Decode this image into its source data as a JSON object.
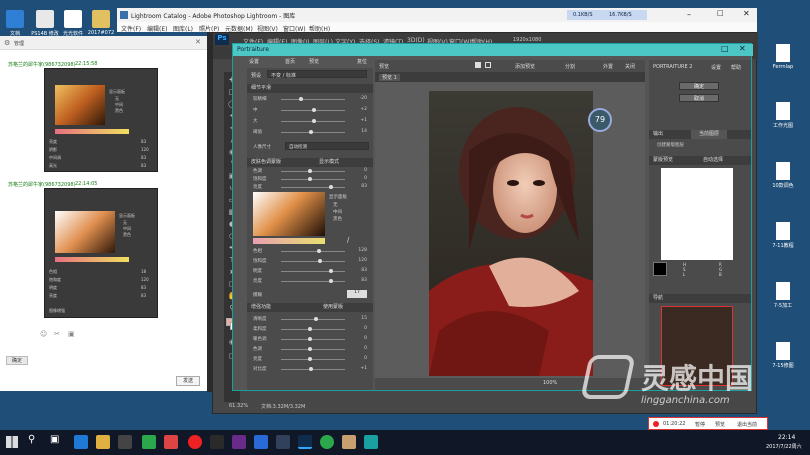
{
  "desktop": {
    "left_icons": [
      {
        "label": "文档"
      },
      {
        "label": "PS14B 修改"
      },
      {
        "label": "光光软件"
      },
      {
        "label": "2017#072"
      }
    ],
    "right_icons": [
      {
        "label": "Ferrnlap"
      },
      {
        "label": "工作光图"
      },
      {
        "label": "10款调色"
      },
      {
        "label": "7-11教程"
      },
      {
        "label": "7-5加工"
      },
      {
        "label": "7-15修图"
      }
    ]
  },
  "lightroom": {
    "title": "Lightroom Catalog - Adobe Photoshop Lightroom - 图库",
    "menu": [
      "文件(F)",
      "编辑(E)",
      "图库(L)",
      "照片(P)",
      "元数据(M)",
      "视图(V)",
      "窗口(W)",
      "帮助(H)"
    ],
    "net_down": "0.1KB/S",
    "net_up": "16.7KB/S"
  },
  "chat": {
    "header": "管理",
    "messages": [
      {
        "name": "苏格兰的犀牛家(986732098)",
        "time": "22:15:58"
      },
      {
        "name": "苏格兰的犀牛家(986732098)",
        "time": "22:14:05"
      }
    ],
    "panel1": {
      "rows": [
        [
          "亮度",
          "83"
        ],
        [
          "阴影",
          "120"
        ],
        [
          "中间调",
          "83"
        ],
        [
          "高光",
          "83"
        ],
        [
          "基本",
          "40"
        ]
      ],
      "options": [
        "显示面板",
        "无",
        "中间",
        "黑色"
      ]
    },
    "panel2": {
      "rows": [
        [
          "色相",
          "18"
        ],
        [
          "饱和度",
          "120"
        ],
        [
          "明度",
          "83"
        ],
        [
          "亮度",
          "83"
        ],
        [
          "基本",
          "40"
        ]
      ],
      "options": [
        "显示面板",
        "无",
        "中间",
        "黑色"
      ]
    },
    "panel2_footer": "图像增强",
    "send_button": "发送",
    "left_button": "确定"
  },
  "photoshop": {
    "logo": "Ps",
    "menu": [
      "文件(F)",
      "编辑(E)",
      "图像(I)",
      "图层(L)",
      "文字(Y)",
      "选择(S)",
      "滤镜(T)",
      "3D(D)",
      "视图(V)",
      "窗口(W)",
      "帮助(H)"
    ],
    "doc_size": "1920x1080",
    "status_zoom": "61.32%",
    "status_doc": "文档:3.32M/3.32M"
  },
  "portraiture": {
    "title": "Portraiture",
    "top_tabs": [
      "设置",
      "首页",
      "预览",
      "复位"
    ],
    "preset_label": "预设",
    "preset_value": "不变 / 标准",
    "preview_label": "预览",
    "preview_tab": "预览 1",
    "view_options": [
      "添加预览",
      "分割",
      "外置",
      "关闭"
    ],
    "zoom": "79",
    "section1": {
      "title": "细节平滑",
      "rows": [
        [
          "较精细",
          "-20",
          0.3
        ],
        [
          "中",
          "+2",
          0.52
        ],
        [
          "大",
          "+1",
          0.51
        ],
        [
          "阈值",
          "14",
          0.46
        ]
      ],
      "dropdown_label": "人像尺寸",
      "dropdown_value": "自动检测"
    },
    "section2": {
      "title": "皮肤色调蒙版",
      "mode_label": "蒙版",
      "mode_value": "显示模式",
      "rows": [
        [
          "色调",
          "0",
          0.45
        ],
        [
          "饱和度",
          "0",
          0.45
        ],
        [
          "亮度",
          "83",
          0.8
        ]
      ],
      "options": [
        "显示面板",
        "无",
        "中间",
        "黑色"
      ],
      "rows2": [
        [
          "色相",
          "128",
          0.6
        ],
        [
          "饱和度",
          "120",
          0.62
        ],
        [
          "明度",
          "83",
          0.8
        ],
        [
          "亮度",
          "83",
          0.8
        ]
      ],
      "extra_label": "模糊",
      "extra_value": "17"
    },
    "section3": {
      "title": "增强功能",
      "checkbox": "使用蒙版",
      "rows": [
        [
          "清晰度",
          "15",
          0.55
        ],
        [
          "柔和度",
          "0",
          0.45
        ],
        [
          "暖色调",
          "0",
          0.45
        ],
        [
          "色调",
          "0",
          0.45
        ],
        [
          "亮度",
          "0",
          0.45
        ],
        [
          "对比度",
          "+1",
          0.47
        ]
      ]
    },
    "right": {
      "title": "PORTRAITURE 2",
      "subtabs": [
        "设置",
        "帮助"
      ],
      "ok": "确定",
      "cancel": "取消",
      "output_label": "输出",
      "output_value": "当前图层",
      "output_check": "创建蒙版图层",
      "mask_label": "蒙版预览",
      "auto_label": "自动选择",
      "picker_codes": [
        "H",
        "S",
        "L",
        "R",
        "G",
        "B"
      ],
      "nav_label": "导航"
    },
    "bottom_zoom": "100%"
  },
  "watermark": {
    "brand": "灵感中国",
    "url": "lingganchina.com"
  },
  "recorder": {
    "time": "01:20:22",
    "buttons": [
      "暂停",
      "预览",
      "退出当前"
    ]
  },
  "taskbar": {
    "time": "22:14",
    "date": "2017/7/22周六"
  },
  "colors": {
    "desktop": "#1f4e78",
    "ps_dark": "#474747",
    "portraiture_title": "#4dc6c6",
    "taskbar": "#101828",
    "red_dress": "#8a1d1a"
  }
}
